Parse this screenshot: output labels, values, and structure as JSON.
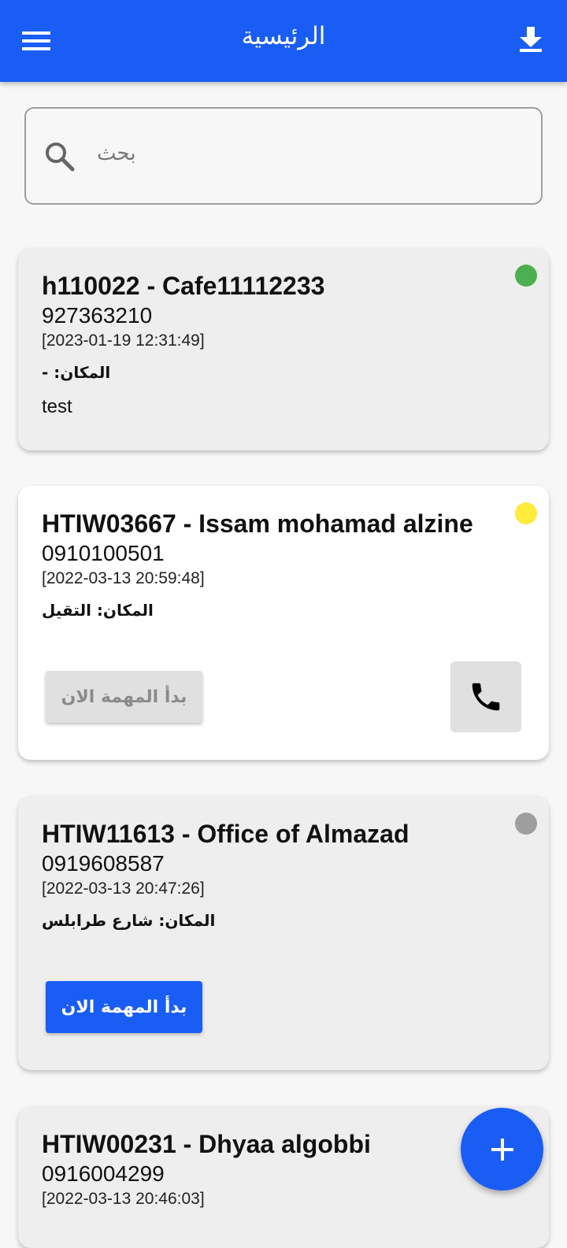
{
  "header": {
    "title": "الرئيسية",
    "menu_icon": "menu-icon",
    "download_icon": "download-icon"
  },
  "search": {
    "placeholder": "بحث",
    "icon": "search-icon"
  },
  "tasks": [
    {
      "heading": "h110022 - Cafe11112233",
      "phone": "927363210",
      "date": "[2023-01-19 12:31:49]",
      "location": "المكان:  -",
      "note": "test",
      "status_color": "#4caf50",
      "card_bg": "#eeeeee"
    },
    {
      "heading": "HTIW03667 - Issam mohamad alzine",
      "phone": "0910100501",
      "date": "[2022-03-13 20:59:48]",
      "location": "المكان:  التقيل",
      "start_label": "بدأ المهمة الان",
      "start_enabled": false,
      "call_icon": "phone-icon",
      "status_color": "#ffeb3b",
      "card_bg": "#ffffff"
    },
    {
      "heading": "HTIW11613 - Office of Almazad",
      "phone": "0919608587",
      "date": "[2022-03-13 20:47:26]",
      "location": "المكان:  شارع طرابلس",
      "start_label": "بدأ المهمة الان",
      "start_enabled": true,
      "status_color": "#9e9e9e",
      "card_bg": "#eeeeee"
    },
    {
      "heading": "HTIW00231 - Dhyaa algobbi",
      "phone": "0916004299",
      "date": "[2022-03-13 20:46:03]",
      "card_bg": "#eeeeee"
    }
  ],
  "fab": {
    "icon": "plus-icon"
  },
  "colors": {
    "primary": "#1a5df5",
    "disabled_button": "#e0e0e0"
  }
}
